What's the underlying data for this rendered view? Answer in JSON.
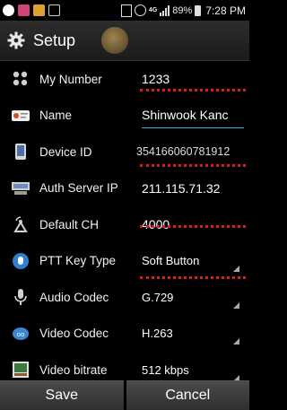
{
  "status_bar": {
    "battery": "89%",
    "time": "7:28 PM",
    "network_badge": "4G"
  },
  "title_bar": {
    "title": "Setup"
  },
  "settings": [
    {
      "label": "My Number",
      "value": "1233",
      "icon": "phone-number-icon"
    },
    {
      "label": "Name",
      "value": "Shinwook Kanc",
      "icon": "name-card-icon"
    },
    {
      "label": "Device ID",
      "value": "354166060781912",
      "icon": "device-icon"
    },
    {
      "label": "Auth Server IP",
      "value": "211.115.71.32",
      "icon": "server-icon"
    },
    {
      "label": "Default CH",
      "value": "4000",
      "icon": "antenna-icon"
    },
    {
      "label": "PTT Key Type",
      "value": "Soft Button",
      "icon": "ptt-button-icon"
    },
    {
      "label": "Audio Codec",
      "value": "G.729",
      "icon": "microphone-icon"
    },
    {
      "label": "Video Codec",
      "value": "H.263",
      "icon": "video-codec-icon"
    },
    {
      "label": "Video bitrate",
      "value": "512 kbps",
      "icon": "video-bitrate-icon"
    }
  ],
  "buttons": {
    "save": "Save",
    "cancel": "Cancel"
  },
  "colors": {
    "annotation_red": "#d81e1e",
    "edit_underline": "#3aa6d0"
  }
}
